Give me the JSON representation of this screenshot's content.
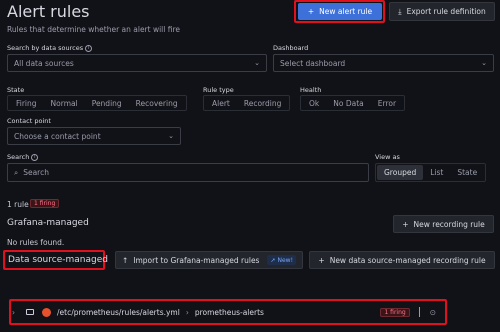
{
  "header": {
    "title": "Alert rules",
    "subtitle": "Rules that determine whether an alert will fire",
    "new_alert_rule": "New alert rule",
    "export_rule_definition": "Export rule definition"
  },
  "filters": {
    "data_sources_label": "Search by data sources",
    "data_sources_value": "All data sources",
    "dashboard_label": "Dashboard",
    "dashboard_placeholder": "Select dashboard",
    "state_label": "State",
    "state_options": [
      "Firing",
      "Normal",
      "Pending",
      "Recovering"
    ],
    "rule_type_label": "Rule type",
    "rule_type_options": [
      "Alert",
      "Recording"
    ],
    "health_label": "Health",
    "health_options": [
      "Ok",
      "No Data",
      "Error"
    ],
    "contact_point_label": "Contact point",
    "contact_point_placeholder": "Choose a contact point",
    "search_label": "Search",
    "search_placeholder": "Search",
    "view_as_label": "View as",
    "view_as_options": [
      "Grouped",
      "List",
      "State"
    ],
    "view_as_selected": "Grouped"
  },
  "summary": {
    "rule_count": "1 rule",
    "firing_badge": "1 firing"
  },
  "grafana_managed": {
    "title": "Grafana-managed",
    "new_recording_rule": "New recording rule",
    "empty_text": "No rules found."
  },
  "datasource_managed": {
    "title": "Data source-managed",
    "import_button": "Import to Grafana-managed rules",
    "new_badge": "New!",
    "new_recording_rule": "New data source-managed recording rule"
  },
  "rule_group": {
    "path": "/etc/prometheus/rules/alerts.yml",
    "separator": "›",
    "group_name": "prometheus-alerts",
    "firing_badge": "1 firing"
  },
  "colors": {
    "background": "#111217",
    "primary": "#3d71d9",
    "highlight_red": "#e0101f",
    "prometheus_orange": "#e6522c"
  }
}
